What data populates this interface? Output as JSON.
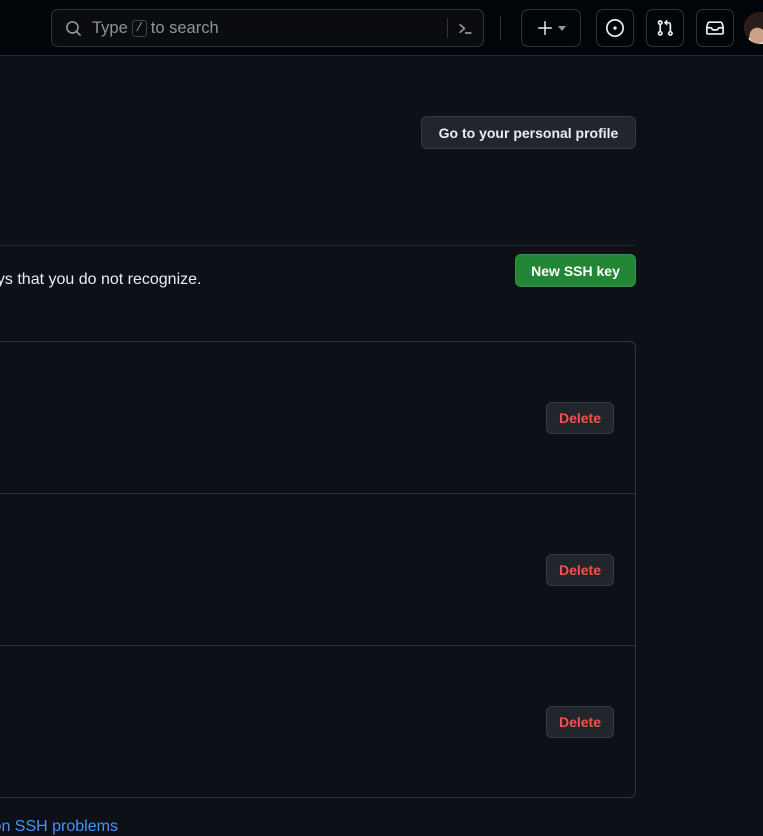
{
  "header": {
    "search": {
      "placeholder_prefix": "Type",
      "key_badge": "/",
      "placeholder_suffix": "to search",
      "terminal_icon": "terminal-icon",
      "search_icon": "search-icon"
    },
    "actions": [
      {
        "name": "create-new-menu",
        "icon": "plus-icon",
        "label": "Create new..."
      },
      {
        "name": "issues",
        "icon": "issue-opened-icon",
        "label": "Issues"
      },
      {
        "name": "pull-requests",
        "icon": "git-pull-request-icon",
        "label": "Pull requests"
      },
      {
        "name": "notifications",
        "icon": "inbox-icon",
        "label": "Notifications"
      }
    ],
    "avatar": {
      "name": "user-avatar",
      "label": "Open user account menu"
    }
  },
  "main": {
    "profile_button_label": "Go to your personal profile",
    "new_ssh_key_label": "New SSH key",
    "notice_text": "keys that you do not recognize.",
    "keys": [
      {
        "delete_label": "Delete"
      },
      {
        "delete_label": "Delete"
      },
      {
        "delete_label": "Delete"
      }
    ],
    "footer_link_label": "ommon SSH problems"
  },
  "colors": {
    "page_background": "#0d1117",
    "header_background": "#010409",
    "border": "#2f353d",
    "accent_green": "#238636",
    "danger_red": "#f85149",
    "link_blue": "#4493f8",
    "text_primary": "#e6edf3",
    "text_muted": "#8b949e",
    "button_background": "#21262d"
  }
}
